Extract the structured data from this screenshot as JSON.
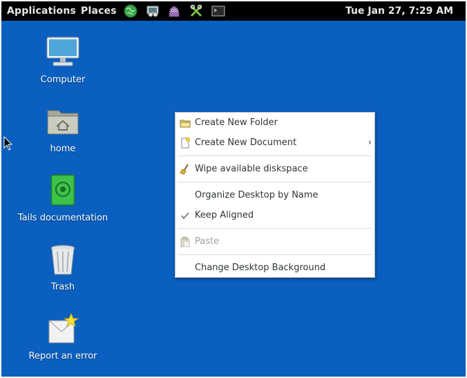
{
  "top_panel": {
    "applications_label": "Applications",
    "places_label": "Places",
    "launchers": [
      {
        "icon": "tor-browser-icon"
      },
      {
        "icon": "network-icon"
      },
      {
        "icon": "pidgin-icon"
      },
      {
        "icon": "keepassx-icon"
      },
      {
        "icon": "terminal-icon"
      }
    ],
    "clock": "Tue Jan 27,  7:29 AM"
  },
  "desktop": {
    "background_color": "#0a5fbf",
    "icons": [
      {
        "label": "Computer",
        "icon": "computer-icon"
      },
      {
        "label": "home",
        "icon": "home-folder-icon"
      },
      {
        "label": "Tails documentation",
        "icon": "tails-documentation-icon"
      },
      {
        "label": "Trash",
        "icon": "trash-icon"
      },
      {
        "label": "Report an error",
        "icon": "report-error-icon"
      }
    ]
  },
  "context_menu": {
    "items": [
      {
        "label": "Create New Folder",
        "icon": "folder-new-icon"
      },
      {
        "label": "Create New Document",
        "icon": "document-new-icon",
        "submenu": true
      },
      {
        "label": "Wipe available diskspace",
        "icon": "broom-icon"
      },
      {
        "label": "Organize Desktop by Name"
      },
      {
        "label": "Keep Aligned",
        "checked": true
      },
      {
        "label": "Paste",
        "icon": "paste-icon",
        "disabled": true
      },
      {
        "label": "Change Desktop Background"
      }
    ]
  }
}
